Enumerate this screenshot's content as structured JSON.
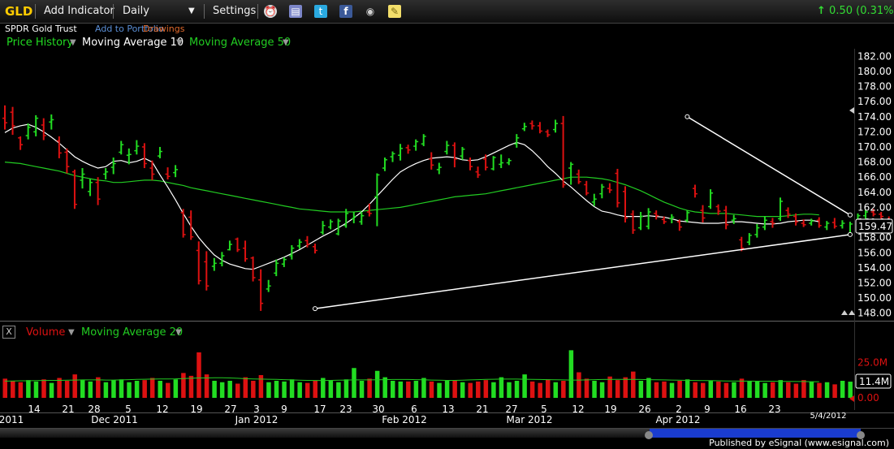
{
  "toolbar": {
    "symbol": "GLD",
    "add_indicator": "Add Indicator",
    "interval": "Daily",
    "settings": "Settings",
    "change": "0.50 (0.31%)"
  },
  "subheader": {
    "name": "SPDR Gold Trust",
    "add_portfolio": "Add to Portfolio",
    "drawings": "Drawings"
  },
  "price_legend": [
    "Price History",
    "Moving Average 10",
    "Moving Average 50"
  ],
  "volume_legend": [
    "Volume",
    "Moving Average 20"
  ],
  "volume_close_label": "X",
  "date_stamp": "5/4/2012",
  "footer": "Published by eSignal (www.esignal.com)",
  "colors": {
    "up": "#22dd22",
    "down": "#dd1111",
    "ma10": "#ffffff",
    "ma50": "#22cc22",
    "ma20": "#22cc22",
    "symbol": "#ffcc00",
    "link": "#5b8fd6",
    "drawings": "#e26a2c"
  },
  "chart_data": [
    {
      "type": "ohlc",
      "symbol": "GLD",
      "ylim": [
        147,
        183
      ],
      "yticks": [
        148,
        150,
        152,
        154,
        156,
        158,
        160,
        162,
        164,
        166,
        168,
        170,
        172,
        174,
        176,
        178,
        180,
        182
      ],
      "last_price_label": "159.47",
      "xtick_labels": [
        "2011",
        "14",
        "21",
        "28",
        "5",
        "Dec 2011",
        "12",
        "19",
        "27",
        "3",
        "Jan 2012",
        "9",
        "17",
        "23",
        "30",
        "Feb 2012",
        "6",
        "13",
        "21",
        "27",
        "Mar 2012",
        "5",
        "12",
        "19",
        "26",
        "Apr 2012",
        "2",
        "9",
        "16",
        "23"
      ],
      "bars": [
        {
          "o": 173.8,
          "h": 175.5,
          "l": 172.3,
          "c": 173.2
        },
        {
          "o": 174.6,
          "h": 175.3,
          "l": 171.6,
          "c": 172.8
        },
        {
          "o": 171.2,
          "h": 171.4,
          "l": 169.6,
          "c": 170.3
        },
        {
          "o": 171.5,
          "h": 173.1,
          "l": 171.0,
          "c": 172.6
        },
        {
          "o": 172.0,
          "h": 174.2,
          "l": 171.4,
          "c": 173.8
        },
        {
          "o": 172.9,
          "h": 173.8,
          "l": 170.9,
          "c": 171.5
        },
        {
          "o": 173.3,
          "h": 174.3,
          "l": 172.3,
          "c": 173.6
        },
        {
          "o": 170.8,
          "h": 171.4,
          "l": 168.5,
          "c": 169.2
        },
        {
          "o": 169.3,
          "h": 169.8,
          "l": 166.5,
          "c": 167.4
        },
        {
          "o": 166.7,
          "h": 167.0,
          "l": 161.8,
          "c": 162.4
        },
        {
          "o": 165.6,
          "h": 167.2,
          "l": 164.5,
          "c": 166.4
        },
        {
          "o": 164.1,
          "h": 165.8,
          "l": 163.5,
          "c": 165.3
        },
        {
          "o": 165.3,
          "h": 166.0,
          "l": 162.3,
          "c": 163.1
        },
        {
          "o": 166.4,
          "h": 167.2,
          "l": 165.7,
          "c": 166.7
        },
        {
          "o": 167.3,
          "h": 168.6,
          "l": 166.4,
          "c": 167.8
        },
        {
          "o": 169.3,
          "h": 170.8,
          "l": 169.0,
          "c": 170.3
        },
        {
          "o": 168.9,
          "h": 169.8,
          "l": 167.7,
          "c": 169.0
        },
        {
          "o": 169.5,
          "h": 170.9,
          "l": 169.0,
          "c": 170.1
        },
        {
          "o": 170.0,
          "h": 170.5,
          "l": 167.2,
          "c": 167.8
        },
        {
          "o": 167.2,
          "h": 168.2,
          "l": 165.6,
          "c": 166.4
        },
        {
          "o": 168.8,
          "h": 170.0,
          "l": 168.5,
          "c": 169.4
        },
        {
          "o": 166.4,
          "h": 167.3,
          "l": 165.7,
          "c": 166.1
        },
        {
          "o": 166.6,
          "h": 167.6,
          "l": 166.0,
          "c": 167.0
        },
        {
          "o": 161.3,
          "h": 161.8,
          "l": 158.0,
          "c": 158.4
        },
        {
          "o": 160.7,
          "h": 161.6,
          "l": 157.7,
          "c": 158.1
        },
        {
          "o": 156.3,
          "h": 157.5,
          "l": 151.8,
          "c": 152.3
        },
        {
          "o": 154.8,
          "h": 156.2,
          "l": 151.0,
          "c": 151.6
        },
        {
          "o": 154.2,
          "h": 155.3,
          "l": 153.6,
          "c": 154.6
        },
        {
          "o": 154.6,
          "h": 156.1,
          "l": 154.2,
          "c": 155.6
        },
        {
          "o": 156.4,
          "h": 157.6,
          "l": 156.3,
          "c": 157.1
        },
        {
          "o": 157.8,
          "h": 158.0,
          "l": 156.1,
          "c": 156.4
        },
        {
          "o": 156.6,
          "h": 157.6,
          "l": 154.8,
          "c": 155.2
        },
        {
          "o": 155.3,
          "h": 155.5,
          "l": 152.2,
          "c": 152.7
        },
        {
          "o": 152.4,
          "h": 153.8,
          "l": 148.3,
          "c": 149.3
        },
        {
          "o": 151.2,
          "h": 152.4,
          "l": 150.8,
          "c": 151.6
        },
        {
          "o": 153.3,
          "h": 155.1,
          "l": 152.9,
          "c": 154.6
        },
        {
          "o": 154.5,
          "h": 155.4,
          "l": 154.1,
          "c": 155.1
        },
        {
          "o": 155.6,
          "h": 157.0,
          "l": 155.1,
          "c": 156.6
        },
        {
          "o": 156.9,
          "h": 157.8,
          "l": 156.5,
          "c": 157.4
        },
        {
          "o": 157.6,
          "h": 158.2,
          "l": 156.7,
          "c": 157.1
        },
        {
          "o": 156.8,
          "h": 157.2,
          "l": 155.9,
          "c": 156.3
        },
        {
          "o": 158.7,
          "h": 160.2,
          "l": 158.4,
          "c": 159.6
        },
        {
          "o": 159.4,
          "h": 160.4,
          "l": 159.1,
          "c": 160.1
        },
        {
          "o": 158.5,
          "h": 160.5,
          "l": 158.3,
          "c": 160.2
        },
        {
          "o": 159.6,
          "h": 161.8,
          "l": 159.3,
          "c": 161.2
        },
        {
          "o": 160.5,
          "h": 161.4,
          "l": 159.9,
          "c": 160.8
        },
        {
          "o": 160.1,
          "h": 161.4,
          "l": 159.7,
          "c": 160.9
        },
        {
          "o": 161.4,
          "h": 162.5,
          "l": 160.8,
          "c": 161.2
        },
        {
          "o": 163.4,
          "h": 166.5,
          "l": 159.5,
          "c": 166.3
        },
        {
          "o": 167.2,
          "h": 168.6,
          "l": 166.8,
          "c": 168.3
        },
        {
          "o": 168.7,
          "h": 169.4,
          "l": 168.0,
          "c": 169.1
        },
        {
          "o": 168.9,
          "h": 170.4,
          "l": 168.2,
          "c": 169.8
        },
        {
          "o": 169.9,
          "h": 170.3,
          "l": 169.1,
          "c": 169.6
        },
        {
          "o": 170.1,
          "h": 171.0,
          "l": 169.5,
          "c": 170.7
        },
        {
          "o": 170.4,
          "h": 171.7,
          "l": 170.1,
          "c": 171.4
        },
        {
          "o": 168.4,
          "h": 169.3,
          "l": 167.0,
          "c": 167.6
        },
        {
          "o": 167.0,
          "h": 167.9,
          "l": 166.4,
          "c": 167.3
        },
        {
          "o": 169.4,
          "h": 170.8,
          "l": 169.0,
          "c": 170.2
        },
        {
          "o": 170.2,
          "h": 170.6,
          "l": 167.3,
          "c": 168.4
        },
        {
          "o": 168.8,
          "h": 170.0,
          "l": 168.3,
          "c": 169.7
        },
        {
          "o": 168.2,
          "h": 168.6,
          "l": 166.9,
          "c": 167.4
        },
        {
          "o": 166.7,
          "h": 167.4,
          "l": 165.9,
          "c": 166.3
        },
        {
          "o": 168.4,
          "h": 169.0,
          "l": 166.9,
          "c": 167.3
        },
        {
          "o": 167.1,
          "h": 168.8,
          "l": 166.9,
          "c": 168.6
        },
        {
          "o": 167.7,
          "h": 169.0,
          "l": 167.2,
          "c": 167.9
        },
        {
          "o": 167.9,
          "h": 168.5,
          "l": 167.6,
          "c": 168.2
        },
        {
          "o": 170.4,
          "h": 171.7,
          "l": 169.9,
          "c": 171.2
        },
        {
          "o": 172.4,
          "h": 173.2,
          "l": 172.1,
          "c": 172.7
        },
        {
          "o": 173.1,
          "h": 173.5,
          "l": 172.3,
          "c": 172.8
        },
        {
          "o": 172.8,
          "h": 173.3,
          "l": 171.8,
          "c": 172.1
        },
        {
          "o": 172.0,
          "h": 172.3,
          "l": 171.3,
          "c": 171.6
        },
        {
          "o": 172.3,
          "h": 173.6,
          "l": 171.9,
          "c": 173.1
        },
        {
          "o": 173.1,
          "h": 174.1,
          "l": 164.6,
          "c": 165.0
        },
        {
          "o": 167.2,
          "h": 168.0,
          "l": 165.0,
          "c": 167.7
        },
        {
          "o": 166.4,
          "h": 167.0,
          "l": 165.1,
          "c": 165.4
        },
        {
          "o": 165.0,
          "h": 165.5,
          "l": 163.6,
          "c": 163.9
        },
        {
          "o": 162.7,
          "h": 163.8,
          "l": 162.2,
          "c": 163.1
        },
        {
          "o": 163.8,
          "h": 165.1,
          "l": 163.2,
          "c": 164.7
        },
        {
          "o": 164.5,
          "h": 165.2,
          "l": 163.9,
          "c": 164.3
        },
        {
          "o": 166.5,
          "h": 167.1,
          "l": 162.0,
          "c": 162.6
        },
        {
          "o": 164.1,
          "h": 164.8,
          "l": 160.0,
          "c": 160.6
        },
        {
          "o": 161.1,
          "h": 161.6,
          "l": 158.5,
          "c": 159.0
        },
        {
          "o": 159.3,
          "h": 161.4,
          "l": 159.0,
          "c": 160.8
        },
        {
          "o": 159.5,
          "h": 161.9,
          "l": 159.1,
          "c": 161.4
        },
        {
          "o": 161.2,
          "h": 161.6,
          "l": 160.4,
          "c": 160.9
        },
        {
          "o": 160.4,
          "h": 160.8,
          "l": 159.8,
          "c": 160.1
        },
        {
          "o": 160.5,
          "h": 161.1,
          "l": 159.9,
          "c": 160.7
        },
        {
          "o": 160.1,
          "h": 160.4,
          "l": 158.9,
          "c": 159.4
        },
        {
          "o": 160.3,
          "h": 161.6,
          "l": 160.0,
          "c": 161.3
        },
        {
          "o": 164.5,
          "h": 165.0,
          "l": 163.3,
          "c": 163.8
        },
        {
          "o": 161.6,
          "h": 162.3,
          "l": 160.0,
          "c": 160.6
        },
        {
          "o": 162.1,
          "h": 164.4,
          "l": 161.8,
          "c": 163.9
        },
        {
          "o": 162.1,
          "h": 162.4,
          "l": 161.0,
          "c": 161.5
        },
        {
          "o": 161.6,
          "h": 162.2,
          "l": 159.1,
          "c": 159.7
        },
        {
          "o": 160.3,
          "h": 161.0,
          "l": 159.8,
          "c": 160.5
        },
        {
          "o": 157.7,
          "h": 158.1,
          "l": 156.2,
          "c": 156.6
        },
        {
          "o": 157.4,
          "h": 158.6,
          "l": 157.0,
          "c": 158.3
        },
        {
          "o": 158.4,
          "h": 159.8,
          "l": 158.0,
          "c": 159.3
        },
        {
          "o": 159.4,
          "h": 160.8,
          "l": 159.0,
          "c": 160.3
        },
        {
          "o": 160.1,
          "h": 160.6,
          "l": 159.3,
          "c": 159.9
        },
        {
          "o": 160.5,
          "h": 163.3,
          "l": 160.2,
          "c": 162.8
        },
        {
          "o": 161.6,
          "h": 162.0,
          "l": 160.6,
          "c": 161.1
        },
        {
          "o": 160.8,
          "h": 161.2,
          "l": 159.6,
          "c": 160.1
        },
        {
          "o": 159.9,
          "h": 160.4,
          "l": 159.4,
          "c": 159.7
        },
        {
          "o": 159.9,
          "h": 160.5,
          "l": 159.6,
          "c": 160.2
        },
        {
          "o": 160.3,
          "h": 160.7,
          "l": 159.3,
          "c": 159.6
        },
        {
          "o": 159.4,
          "h": 160.2,
          "l": 159.0,
          "c": 159.9
        },
        {
          "o": 160.0,
          "h": 160.6,
          "l": 159.2,
          "c": 159.5
        },
        {
          "o": 159.6,
          "h": 160.3,
          "l": 159.2,
          "c": 159.9
        },
        {
          "o": 158.5,
          "h": 160.1,
          "l": 158.2,
          "c": 159.8
        },
        {
          "o": 159.8,
          "h": 161.2,
          "l": 159.5,
          "c": 160.9
        },
        {
          "o": 160.9,
          "h": 161.7,
          "l": 160.5,
          "c": 161.4
        },
        {
          "o": 161.4,
          "h": 161.8,
          "l": 160.8,
          "c": 161.1
        },
        {
          "o": 161.1,
          "h": 161.4,
          "l": 160.5,
          "c": 160.8
        },
        {
          "o": 160.4,
          "h": 160.8,
          "l": 159.8,
          "c": 160.1
        },
        {
          "o": 159.7,
          "h": 159.9,
          "l": 158.3,
          "c": 158.7
        },
        {
          "o": 158.9,
          "h": 159.9,
          "l": 158.6,
          "c": 159.5
        }
      ],
      "ma10": [
        171.9,
        172.5,
        172.8,
        173.0,
        172.6,
        172.0,
        171.3,
        170.5,
        169.6,
        168.7,
        168.1,
        167.6,
        167.2,
        167.4,
        168.1,
        168.2,
        167.9,
        168.1,
        168.5,
        168.0,
        166.3,
        164.7,
        163.0,
        161.2,
        159.5,
        158.0,
        156.8,
        155.7,
        155.0,
        154.5,
        154.2,
        153.9,
        153.8,
        154.2,
        154.6,
        155.0,
        155.4,
        155.9,
        156.4,
        157.0,
        157.6,
        158.2,
        158.7,
        159.3,
        159.9,
        160.6,
        161.4,
        162.4,
        163.5,
        164.6,
        165.7,
        166.7,
        167.3,
        167.8,
        168.2,
        168.5,
        168.6,
        168.7,
        168.6,
        168.3,
        168.2,
        168.3,
        168.7,
        169.2,
        169.7,
        170.2,
        170.6,
        170.3,
        169.5,
        168.5,
        167.4,
        166.5,
        165.5,
        164.7,
        163.8,
        162.9,
        162.1,
        161.5,
        161.3,
        161.0,
        160.8,
        160.8,
        160.8,
        160.9,
        160.8,
        160.7,
        160.5,
        160.2,
        160.1,
        160.0,
        159.9,
        159.9,
        159.9,
        160.0,
        160.1,
        160.1,
        160.0,
        159.9,
        159.8,
        159.8,
        159.9,
        160.1,
        160.2,
        160.3,
        160.3,
        160.1
      ],
      "ma10_start_index": 0,
      "ma50": [
        168.0,
        167.9,
        167.8,
        167.6,
        167.4,
        167.2,
        167.0,
        166.8,
        166.5,
        166.2,
        166.0,
        165.8,
        165.6,
        165.5,
        165.3,
        165.3,
        165.4,
        165.5,
        165.6,
        165.6,
        165.5,
        165.3,
        165.1,
        164.9,
        164.6,
        164.4,
        164.2,
        164.0,
        163.8,
        163.6,
        163.4,
        163.2,
        163.0,
        162.8,
        162.6,
        162.4,
        162.2,
        162.0,
        161.8,
        161.7,
        161.6,
        161.5,
        161.4,
        161.4,
        161.4,
        161.4,
        161.5,
        161.6,
        161.7,
        161.8,
        161.9,
        162.0,
        162.2,
        162.4,
        162.6,
        162.8,
        163.0,
        163.2,
        163.4,
        163.5,
        163.6,
        163.7,
        163.8,
        164.0,
        164.2,
        164.4,
        164.6,
        164.8,
        165.0,
        165.2,
        165.4,
        165.6,
        165.8,
        166.0,
        166.0,
        166.0,
        165.9,
        165.8,
        165.6,
        165.3,
        165.0,
        164.6,
        164.2,
        163.7,
        163.2,
        162.7,
        162.3,
        161.9,
        161.6,
        161.4,
        161.3,
        161.2,
        161.2,
        161.2,
        161.1,
        161.0,
        160.9,
        160.8,
        160.8,
        160.8,
        160.8,
        160.9,
        161.0,
        161.1,
        161.1,
        161.0
      ],
      "ma50_start_index": 0,
      "trendlines": [
        {
          "from": {
            "i": 40,
            "price": 148.6
          },
          "to": {
            "i": 109,
            "price": 158.4
          }
        },
        {
          "from": {
            "i": 88,
            "price": 174.0
          },
          "to": {
            "i": 109,
            "price": 161.0
          }
        }
      ]
    },
    {
      "type": "volume",
      "units": "M",
      "ylim": [
        0,
        40
      ],
      "yticks": [
        0,
        25
      ],
      "ytick_labels": [
        "0.00",
        "25.0M"
      ],
      "last_value_label": "11.4M",
      "ma20": [
        11.8,
        11.9,
        12.0,
        12.0,
        12.1,
        12.2,
        12.3,
        12.3,
        12.4,
        12.5,
        12.6,
        12.6,
        12.6,
        12.5,
        12.5,
        12.6,
        12.8,
        13.0,
        13.1,
        13.2,
        13.3,
        13.3,
        13.4,
        13.6,
        13.8,
        14.0,
        14.0,
        14.1,
        14.1,
        14.0,
        13.8,
        13.5,
        13.3,
        13.2,
        13.1,
        13.0,
        12.8,
        12.6,
        12.4,
        12.3,
        12.2,
        12.2,
        12.3,
        12.4,
        12.5,
        12.6,
        12.6,
        12.6,
        12.7,
        12.8,
        12.9,
        12.9,
        12.9,
        12.8,
        12.7,
        12.5,
        12.4,
        12.3,
        12.3,
        12.4,
        12.6,
        12.8,
        13.0,
        13.1,
        13.2,
        13.2,
        13.2,
        13.1,
        13.0,
        12.9,
        12.8,
        12.7,
        12.6,
        12.5,
        12.5,
        12.6,
        12.8,
        12.9,
        13.0,
        13.0,
        13.0,
        13.0,
        12.9,
        12.8,
        12.7,
        12.6,
        12.5,
        12.4,
        12.3,
        12.2,
        12.1,
        12.1,
        12.0,
        11.9,
        11.9,
        11.8,
        11.8,
        11.7,
        11.7,
        11.7,
        11.6,
        11.6,
        11.5,
        11.5,
        11.4,
        11.4
      ]
    }
  ]
}
